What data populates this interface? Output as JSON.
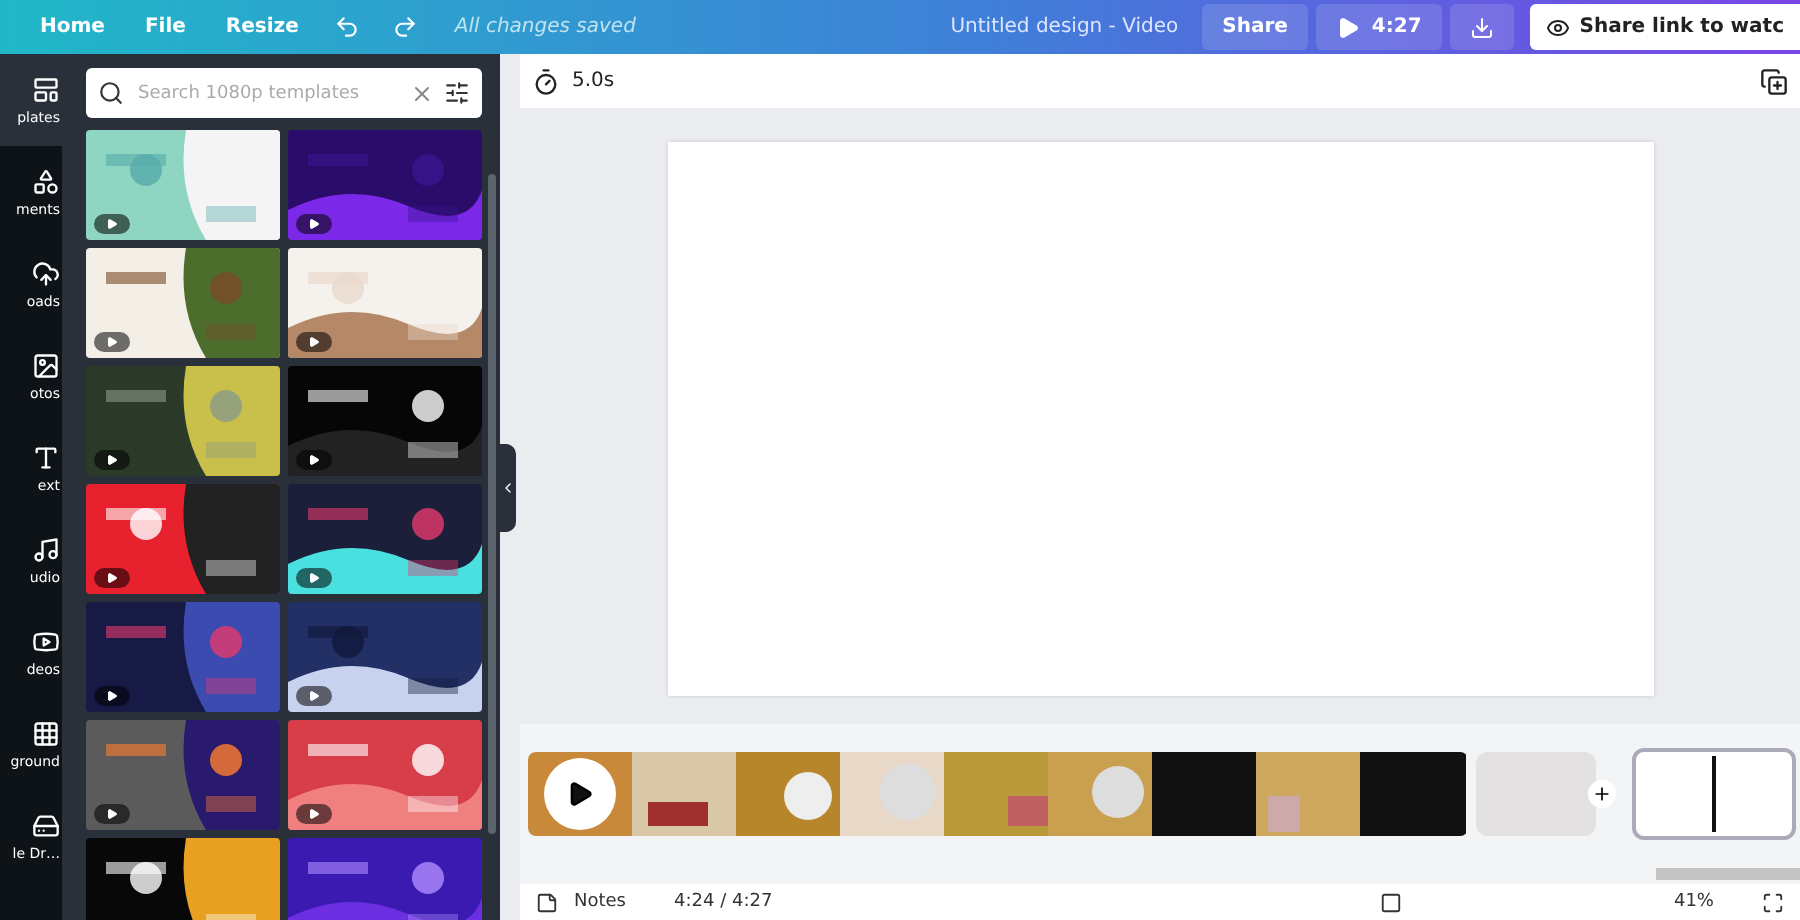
{
  "menu": [
    {
      "label": "Home"
    },
    {
      "label": "File"
    },
    {
      "label": "Resize"
    }
  ],
  "status": "All changes saved",
  "design_title": "Untitled design - Video",
  "share_button": "Share",
  "play_duration": "4:27",
  "share_link": "Share link to watc",
  "rail": [
    {
      "label": "plates",
      "selected": true
    },
    {
      "label": "ments",
      "selected": false
    },
    {
      "label": "oads",
      "selected": false
    },
    {
      "label": "otos",
      "selected": false
    },
    {
      "label": "ext",
      "selected": false
    },
    {
      "label": "udio",
      "selected": false
    },
    {
      "label": "deos",
      "selected": false
    },
    {
      "label": "ground",
      "selected": false
    },
    {
      "label": "le Dr…",
      "selected": false
    }
  ],
  "search": {
    "placeholder": "Search 1080p templates"
  },
  "templates": [
    {
      "kind": "video"
    },
    {
      "kind": "video"
    },
    {
      "kind": "video"
    },
    {
      "kind": "video"
    },
    {
      "kind": "video"
    },
    {
      "kind": "video"
    },
    {
      "kind": "video"
    },
    {
      "kind": "video"
    },
    {
      "kind": "video"
    },
    {
      "kind": "video"
    },
    {
      "kind": "video"
    },
    {
      "kind": "video"
    },
    {
      "kind": "still"
    },
    {
      "kind": "still"
    }
  ],
  "page_duration": "5.0s",
  "scenes": [
    {
      "kind": "video",
      "selected": false
    },
    {
      "kind": "blank",
      "selected": false
    },
    {
      "kind": "blank",
      "selected": true
    }
  ],
  "footer": {
    "notes": "Notes",
    "time": "4:24 / 4:27",
    "zoom": "41%"
  }
}
